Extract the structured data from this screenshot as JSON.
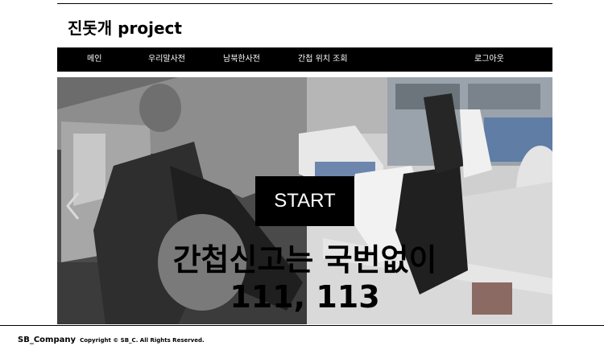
{
  "header": {
    "title": "진돗개 project"
  },
  "nav": {
    "items": [
      {
        "label": "메인"
      },
      {
        "label": "우리말사전"
      },
      {
        "label": "남북한사전"
      },
      {
        "label": "간첩 위치 조회"
      }
    ],
    "logout_label": "로그아웃"
  },
  "hero": {
    "start_label": "START",
    "line1": "간첩신고는 국번없이",
    "line2": "111, 113"
  },
  "footer": {
    "company": "SB_Company",
    "copyright": "Copyright © SB_C. All Rights Reserved."
  },
  "icons": {
    "prev": "chevron-left-icon",
    "next": "chevron-right-icon"
  }
}
